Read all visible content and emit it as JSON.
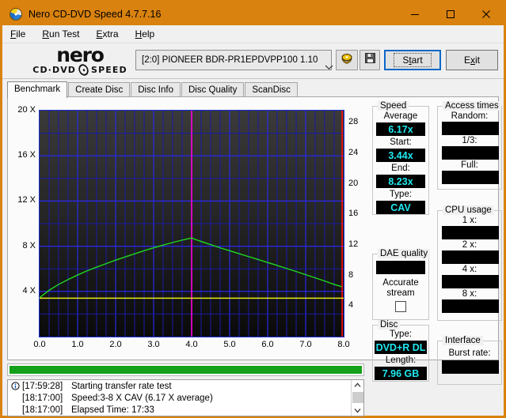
{
  "window": {
    "title": "Nero CD-DVD Speed 4.7.7.16",
    "icon": "nero-disc-icon",
    "minimize_label": "Minimize",
    "maximize_label": "Maximize",
    "close_label": "Close",
    "titlebar_color": "#d9820f"
  },
  "menu": [
    {
      "name": "file",
      "pre": "",
      "accel": "F",
      "post": "ile"
    },
    {
      "name": "run-test",
      "pre": "",
      "accel": "R",
      "post": "un Test"
    },
    {
      "name": "extra",
      "pre": "",
      "accel": "E",
      "post": "xtra"
    },
    {
      "name": "help",
      "pre": "",
      "accel": "H",
      "post": "elp"
    }
  ],
  "toolbar": {
    "logo_main": "nero",
    "logo_sub_left": "CD·DVD",
    "logo_sub_right": "SPEED",
    "drive_value": "[2:0]   PIONEER BDR-PR1EPDVPP100  1.10",
    "eject_label": "Eject",
    "save_label": "Save",
    "start_pre": "S",
    "start_accel": "t",
    "start_post": "art",
    "exit_pre": "E",
    "exit_accel": "x",
    "exit_post": "it"
  },
  "tabs": [
    {
      "name": "benchmark",
      "label": "Benchmark",
      "active": true
    },
    {
      "name": "create-disc",
      "label": "Create Disc",
      "active": false
    },
    {
      "name": "disc-info",
      "label": "Disc Info",
      "active": false
    },
    {
      "name": "disc-quality",
      "label": "Disc Quality",
      "active": false
    },
    {
      "name": "scandisc",
      "label": "ScanDisc",
      "active": false
    }
  ],
  "chart_data": {
    "type": "line",
    "title": "",
    "xlabel": "",
    "ylabel": "",
    "y_left_label": "X",
    "xlim": [
      0.0,
      8.0
    ],
    "ylim_left": [
      0,
      20
    ],
    "ylim_right": [
      0,
      29.6
    ],
    "grid": true,
    "legend": "none",
    "x_ticks": [
      "0.0",
      "1.0",
      "2.0",
      "3.0",
      "4.0",
      "5.0",
      "6.0",
      "7.0",
      "8.0"
    ],
    "y_ticks_left": [
      "20 X",
      "16 X",
      "12 X",
      "8 X",
      "4 X"
    ],
    "y_ticks_left_values": [
      20,
      16,
      12,
      8,
      4
    ],
    "y_ticks_right": [
      "28",
      "24",
      "20",
      "16",
      "12",
      "8",
      "4"
    ],
    "y_ticks_right_values": [
      28,
      24,
      20,
      16,
      12,
      8,
      4
    ],
    "series": [
      {
        "name": "transfer-rate",
        "color": "#1fd81f",
        "x": [
          0.0,
          0.25,
          0.5,
          0.75,
          1.0,
          1.25,
          1.5,
          1.75,
          2.0,
          2.25,
          2.5,
          2.75,
          3.0,
          3.25,
          3.5,
          3.75,
          4.0,
          4.1,
          4.25,
          4.5,
          4.75,
          5.0,
          5.25,
          5.5,
          5.75,
          6.0,
          6.25,
          6.5,
          6.75,
          7.0,
          7.25,
          7.5,
          7.75,
          7.95
        ],
        "y": [
          3.44,
          4.1,
          4.62,
          5.05,
          5.45,
          5.82,
          6.15,
          6.46,
          6.77,
          7.05,
          7.33,
          7.6,
          7.86,
          8.1,
          8.33,
          8.54,
          8.73,
          8.6,
          8.42,
          8.14,
          7.86,
          7.6,
          7.34,
          7.08,
          6.82,
          6.56,
          6.3,
          6.03,
          5.76,
          5.48,
          5.2,
          4.92,
          4.62,
          4.42
        ]
      },
      {
        "name": "cpu-or-seek-baseline",
        "color": "#e8e81e",
        "x": [
          0.0,
          1.0,
          2.0,
          3.0,
          4.0,
          5.0,
          6.0,
          7.0,
          8.0
        ],
        "y": [
          3.4,
          3.4,
          3.4,
          3.4,
          3.4,
          3.4,
          3.4,
          3.4,
          3.4
        ]
      }
    ],
    "markers": [
      {
        "name": "current-position-marker",
        "x": 4.0,
        "color": "#ff00d8"
      },
      {
        "name": "end-of-disc-marker",
        "x": 7.96,
        "color": "#ff1010"
      }
    ]
  },
  "panels": {
    "speed": {
      "title": "Speed",
      "fields": [
        {
          "name": "speed-average",
          "label": "Average",
          "value": "6.17x"
        },
        {
          "name": "speed-start",
          "label": "Start:",
          "value": "3.44x"
        },
        {
          "name": "speed-end",
          "label": "End:",
          "value": "8.23x"
        },
        {
          "name": "speed-type",
          "label": "Type:",
          "value": "CAV"
        }
      ]
    },
    "dae": {
      "title": "DAE quality",
      "value": "",
      "accurate_line1": "Accurate",
      "accurate_line2": "stream",
      "accurate_checked": false
    },
    "disc": {
      "title": "Disc",
      "fields": [
        {
          "name": "disc-type",
          "label": "Type:",
          "value": "DVD+R DL"
        },
        {
          "name": "disc-length",
          "label": "Length:",
          "value": "7.96 GB"
        }
      ]
    },
    "access_times": {
      "title": "Access times",
      "fields": [
        {
          "name": "access-random",
          "label": "Random:",
          "value": ""
        },
        {
          "name": "access-one-third",
          "label": "1/3:",
          "value": ""
        },
        {
          "name": "access-full",
          "label": "Full:",
          "value": ""
        }
      ]
    },
    "cpu_usage": {
      "title": "CPU usage",
      "fields": [
        {
          "name": "cpu-1x",
          "label": "1 x:",
          "value": ""
        },
        {
          "name": "cpu-2x",
          "label": "2 x:",
          "value": ""
        },
        {
          "name": "cpu-4x",
          "label": "4 x:",
          "value": ""
        },
        {
          "name": "cpu-8x",
          "label": "8 x:",
          "value": ""
        }
      ]
    },
    "interface": {
      "title": "Interface",
      "fields": [
        {
          "name": "burst-rate",
          "label": "Burst rate:",
          "value": ""
        }
      ]
    }
  },
  "progress": {
    "percent": 100,
    "color": "#14a01a"
  },
  "log": {
    "rows": [
      {
        "icon": "info-icon",
        "time": "[17:59:28]",
        "message": "Starting transfer rate test"
      },
      {
        "icon": "",
        "time": "[18:17:00]",
        "message": "Speed:3-8 X CAV (6.17 X average)"
      },
      {
        "icon": "",
        "time": "[18:17:00]",
        "message": "Elapsed Time: 17:33"
      }
    ],
    "scroll_up": "▲",
    "scroll_down": "▼"
  }
}
